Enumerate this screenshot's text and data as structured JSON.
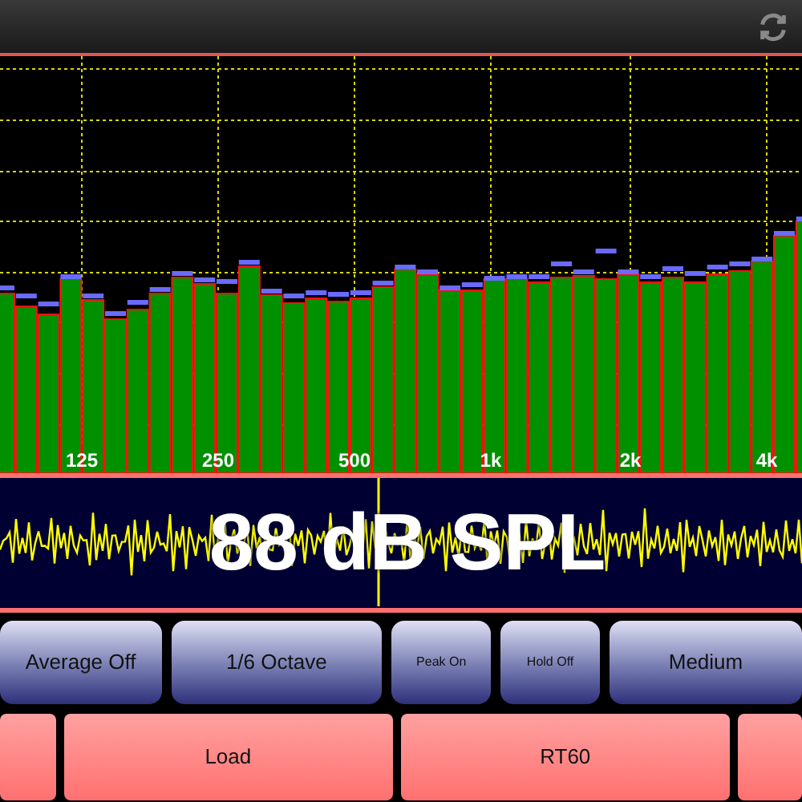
{
  "spectrum": {
    "axis_labels": [
      "125",
      "250",
      "500",
      "1k",
      "2k",
      "4k"
    ]
  },
  "level_display": {
    "reading": "88 dB SPL"
  },
  "controls": [
    {
      "label": "Average Off"
    },
    {
      "label": "1/6 Octave"
    },
    {
      "label": "Peak On",
      "kind": "small"
    },
    {
      "label": "Hold Off",
      "kind": "small"
    },
    {
      "label": "Medium"
    }
  ],
  "actions": [
    {
      "kind": "blank"
    },
    {
      "kind": "text",
      "label": "Load"
    },
    {
      "kind": "text",
      "label": "RT60"
    },
    {
      "kind": "blank"
    }
  ]
}
